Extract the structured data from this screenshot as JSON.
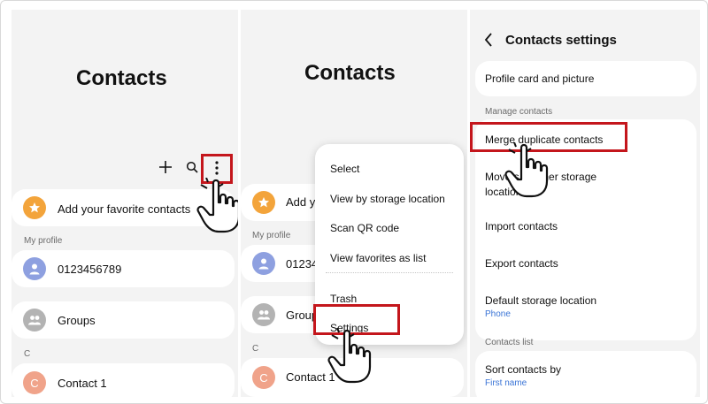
{
  "panel1": {
    "title": "Contacts",
    "add_icon": "plus-icon",
    "search_icon": "search-icon",
    "more_icon": "more-vertical-icon",
    "favorites_label": "Add your favorite contacts",
    "my_profile_header": "My profile",
    "profile_number": "0123456789",
    "groups_label": "Groups",
    "section_letter": "C",
    "contact_initial": "C",
    "contact_name": "Contact 1"
  },
  "panel2": {
    "title": "Contacts",
    "favorites_label": "Add y",
    "my_profile_header": "My profile",
    "profile_number": "01234",
    "groups_label": "Group",
    "section_letter": "C",
    "contact_initial": "C",
    "contact_name": "Contact 1",
    "menu": {
      "items": [
        "Select",
        "View by storage location",
        "Scan QR code",
        "View favorites as list",
        "Trash",
        "Settings"
      ]
    }
  },
  "panel3": {
    "back_icon": "chevron-left-icon",
    "title": "Contacts settings",
    "profile_card": "Profile card and picture",
    "manage_header": "Manage contacts",
    "merge": "Merge duplicate contacts",
    "move_line1": "Move        s to other storage",
    "move_line2": "location",
    "import": "Import contacts",
    "export": "Export contacts",
    "default_storage": "Default storage location",
    "default_storage_value": "Phone",
    "list_header": "Contacts list",
    "sort": "Sort contacts by",
    "sort_value": "First name"
  },
  "colors": {
    "panel_bg": "#f3f3f3",
    "card_bg": "#ffffff",
    "highlight_red": "#c4161c",
    "favorite_orange": "#f3a43b",
    "profile_blue": "#8ea0e0",
    "groups_gray": "#b3b3b3",
    "contact_salmon": "#f0a38a",
    "link_blue": "#3a74d6"
  }
}
